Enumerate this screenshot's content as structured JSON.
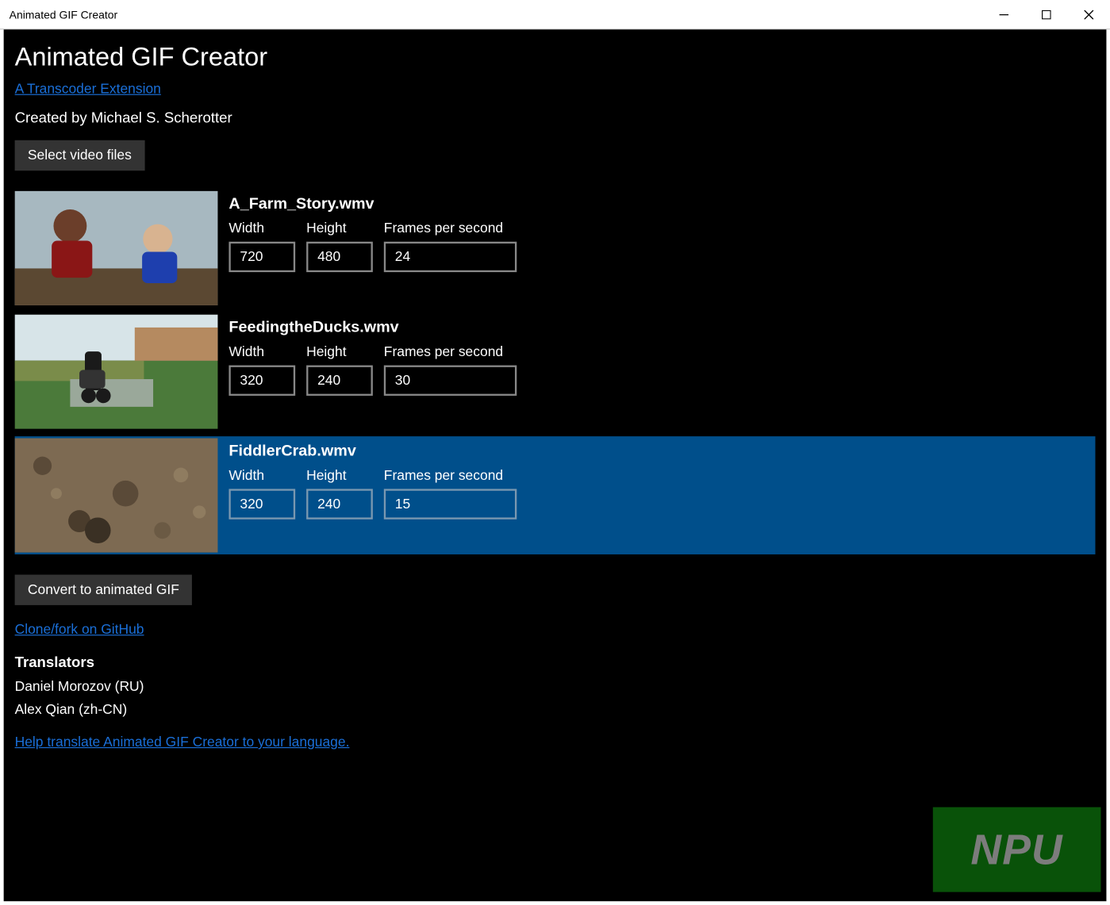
{
  "window": {
    "title": "Animated GIF Creator"
  },
  "header": {
    "page_title": "Animated GIF Creator",
    "subtitle_link": "A Transcoder Extension",
    "created_by": "Created by Michael S. Scherotter",
    "select_button": "Select video files"
  },
  "labels": {
    "width": "Width",
    "height": "Height",
    "fps": "Frames per second"
  },
  "videos": [
    {
      "filename": "A_Farm_Story.wmv",
      "width": "720",
      "height": "480",
      "fps": "24",
      "selected": false
    },
    {
      "filename": "FeedingtheDucks.wmv",
      "width": "320",
      "height": "240",
      "fps": "30",
      "selected": false
    },
    {
      "filename": "FiddlerCrab.wmv",
      "width": "320",
      "height": "240",
      "fps": "15",
      "selected": true
    }
  ],
  "footer": {
    "convert_button": "Convert to animated GIF",
    "github_link": "Clone/fork on GitHub",
    "translators_heading": "Translators",
    "translators": [
      "Daniel Morozov (RU)",
      "Alex Qian (zh-CN)"
    ],
    "help_link": "Help translate Animated GIF Creator to your language."
  },
  "watermark": "NPU"
}
